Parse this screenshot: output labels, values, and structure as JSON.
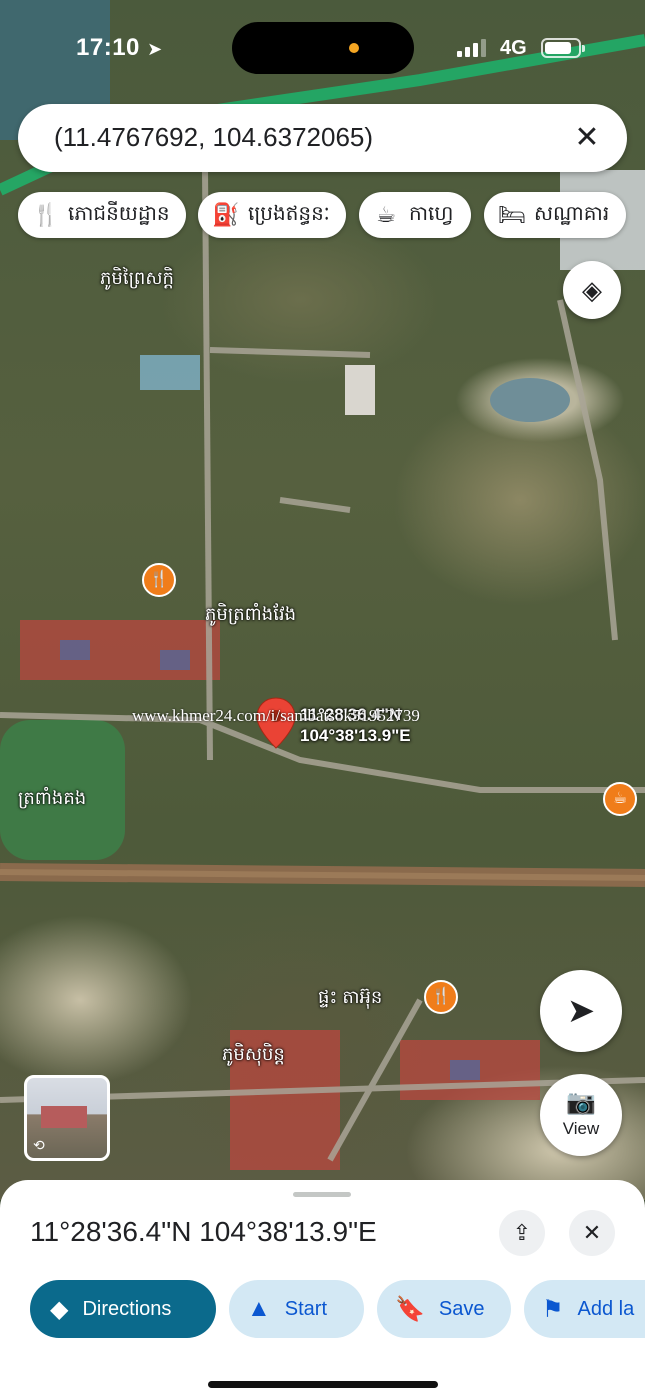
{
  "status_bar": {
    "time": "17:10",
    "network": "4G",
    "battery_percent": 80
  },
  "search": {
    "query": "(11.4767692, 104.6372065)",
    "close_icon": "close-icon"
  },
  "chips": [
    {
      "label": "ភោជនីយដ្ឋាន",
      "icon": "restaurant-icon"
    },
    {
      "label": "ប្រេងឥន្ធនៈ",
      "icon": "gas-station-icon"
    },
    {
      "label": "កាហ្វេ",
      "icon": "coffee-icon"
    },
    {
      "label": "សណ្ឋាគារ",
      "icon": "hotel-icon"
    }
  ],
  "map": {
    "place_labels": [
      "ភូមិព្រៃសក្តិ",
      "ភូមិត្រពាំងវែង",
      "ត្រពាំងគង",
      "ផ្ទះ តាអ៊ុន",
      "ភូមិសុបិន្ត"
    ],
    "pin_label_line1": "11°28'36.4\"N",
    "pin_label_line2": "104°38'13.9\"E",
    "watermark": "www.khmer24.com/i/sambatsok51952739"
  },
  "view_button": {
    "label": "View"
  },
  "sheet": {
    "coordinates": "11°28'36.4\"N 104°38'13.9\"E",
    "actions": [
      {
        "label": "Directions",
        "icon": "directions-icon"
      },
      {
        "label": "Start",
        "icon": "navigation-icon"
      },
      {
        "label": "Save",
        "icon": "bookmark-icon"
      },
      {
        "label": "Add la",
        "icon": "flag-icon"
      }
    ]
  },
  "colors": {
    "primary_action": "#0b6a8c",
    "action_bg": "#d3e8f4",
    "pin": "#ea4335",
    "poi": "#f07d1a"
  }
}
